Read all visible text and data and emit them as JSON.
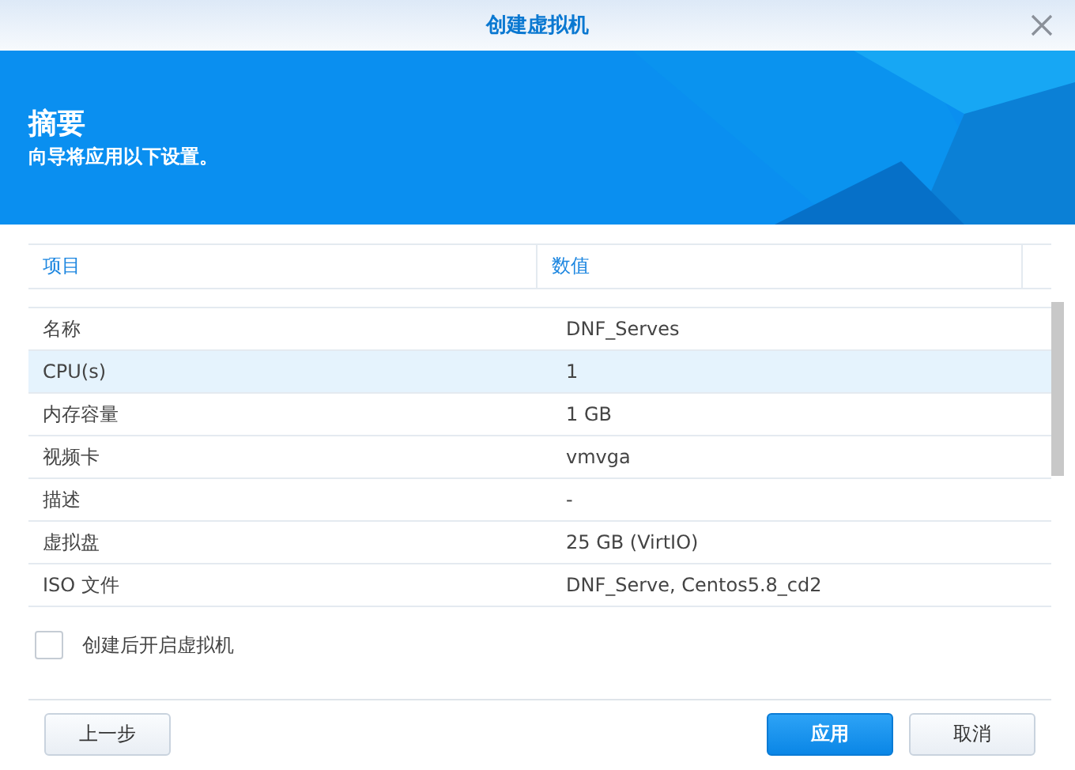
{
  "window": {
    "title": "创建虚拟机"
  },
  "banner": {
    "title": "摘要",
    "subtitle": "向导将应用以下设置。"
  },
  "table": {
    "columns": [
      "项目",
      "数值"
    ],
    "rows": [
      {
        "item": "名称",
        "value": "DNF_Serves",
        "selected": false
      },
      {
        "item": "CPU(s)",
        "value": "1",
        "selected": true
      },
      {
        "item": "内存容量",
        "value": "1 GB",
        "selected": false
      },
      {
        "item": "视频卡",
        "value": "vmvga",
        "selected": false
      },
      {
        "item": "描述",
        "value": "-",
        "selected": false
      },
      {
        "item": "虚拟盘",
        "value": "25 GB (VirtIO)",
        "selected": false
      },
      {
        "item": "ISO 文件",
        "value": "DNF_Serve, Centos5.8_cd2",
        "selected": false
      }
    ]
  },
  "checkbox": {
    "label": "创建后开启虚拟机",
    "checked": false
  },
  "buttons": {
    "back": "上一步",
    "apply": "应用",
    "cancel": "取消"
  }
}
